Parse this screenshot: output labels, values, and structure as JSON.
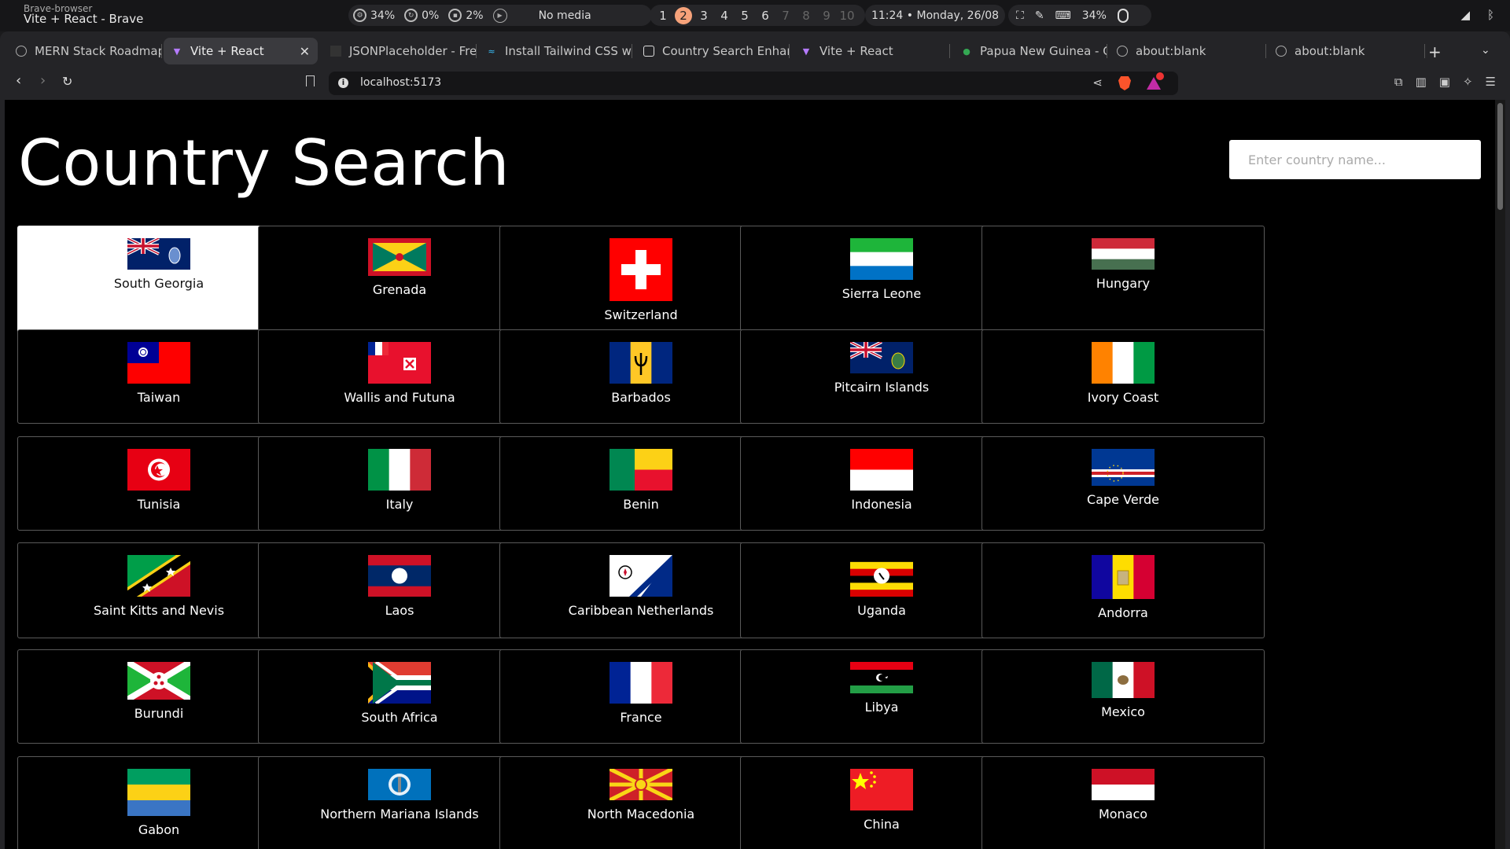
{
  "os": {
    "app_name": "Brave-browser",
    "window_title": "Vite + React - Brave",
    "cpu": "34%",
    "gpu": "0%",
    "mem": "2%",
    "media": "No media",
    "workspaces": [
      "1",
      "2",
      "3",
      "4",
      "5",
      "6",
      "7",
      "8",
      "9",
      "10"
    ],
    "active_workspace": "2",
    "clock": "11:24 • Monday, 26/08",
    "battery": "34%"
  },
  "tabs": [
    {
      "label": "MERN Stack Roadmap"
    },
    {
      "label": "Vite + React"
    },
    {
      "label": "JSONPlaceholder - Fre"
    },
    {
      "label": "Install Tailwind CSS w"
    },
    {
      "label": "Country Search Enhan"
    },
    {
      "label": "Vite + React"
    },
    {
      "label": "Papua New Guinea - G"
    },
    {
      "label": "about:blank"
    },
    {
      "label": "about:blank"
    }
  ],
  "toolbar": {
    "url": "localhost:5173"
  },
  "page": {
    "title": "Country Search",
    "search_placeholder": "Enter country name..."
  },
  "countries": [
    {
      "name": "South Georgia"
    },
    {
      "name": "Grenada"
    },
    {
      "name": "Switzerland"
    },
    {
      "name": "Sierra Leone"
    },
    {
      "name": "Hungary"
    },
    {
      "name": "Taiwan"
    },
    {
      "name": "Wallis and Futuna"
    },
    {
      "name": "Barbados"
    },
    {
      "name": "Pitcairn Islands"
    },
    {
      "name": "Ivory Coast"
    },
    {
      "name": "Tunisia"
    },
    {
      "name": "Italy"
    },
    {
      "name": "Benin"
    },
    {
      "name": "Indonesia"
    },
    {
      "name": "Cape Verde"
    },
    {
      "name": "Saint Kitts and Nevis"
    },
    {
      "name": "Laos"
    },
    {
      "name": "Caribbean Netherlands"
    },
    {
      "name": "Uganda"
    },
    {
      "name": "Andorra"
    },
    {
      "name": "Burundi"
    },
    {
      "name": "South Africa"
    },
    {
      "name": "France"
    },
    {
      "name": "Libya"
    },
    {
      "name": "Mexico"
    },
    {
      "name": "Gabon"
    },
    {
      "name": "Northern Mariana Islands"
    },
    {
      "name": "North Macedonia"
    },
    {
      "name": "China"
    },
    {
      "name": "Monaco"
    }
  ]
}
